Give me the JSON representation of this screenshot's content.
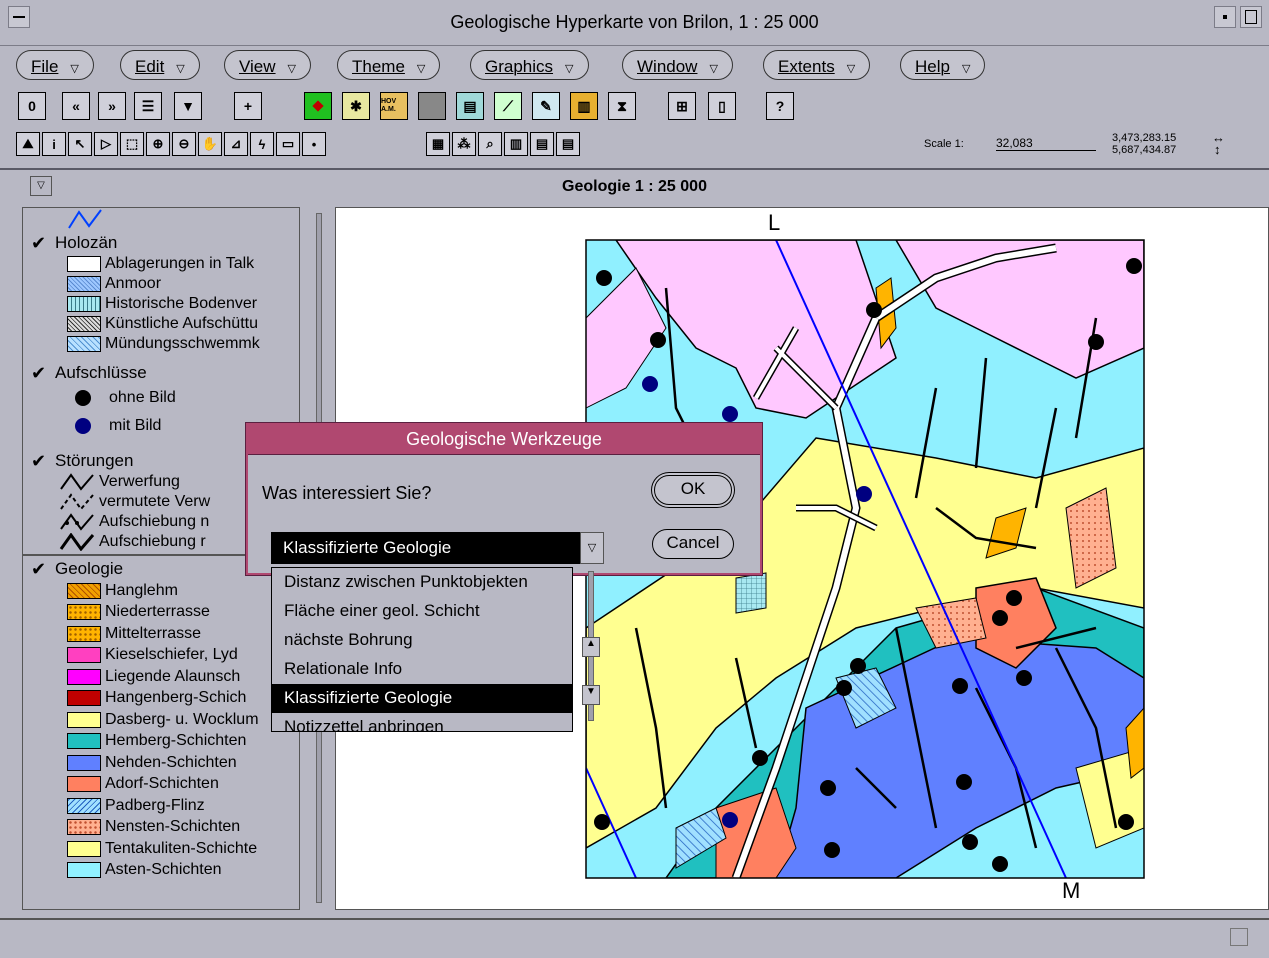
{
  "window": {
    "title": "Geologische Hyperkarte von Brilon, 1 : 25 000"
  },
  "menus": [
    {
      "label": "File"
    },
    {
      "label": "Edit"
    },
    {
      "label": "View"
    },
    {
      "label": "Theme"
    },
    {
      "label": "Graphics"
    },
    {
      "label": "Window"
    },
    {
      "label": "Extents"
    },
    {
      "label": "Help"
    }
  ],
  "toolbar1": {
    "zero_label": "0",
    "prev_label": "«",
    "next_label": "»",
    "hov_label": "HOV A.M."
  },
  "scale": {
    "label": "Scale 1:",
    "value": "32,083",
    "x": "3,473,283.15",
    "y": "5,687,434.87"
  },
  "view": {
    "title": "Geologie 1 : 25 000"
  },
  "legend": {
    "holozaen": {
      "label": "Holozän",
      "items": [
        {
          "label": "Ablagerungen in Talk",
          "color": "#ffffff"
        },
        {
          "label": "Anmoor",
          "color": "#9ec8ff"
        },
        {
          "label": "Historische Bodenver",
          "color": "#a8e8f0"
        },
        {
          "label": "Künstliche Aufschüttu",
          "color": "#c8c8c8"
        },
        {
          "label": "Mündungsschwemmk",
          "color": "#b8e0ff"
        }
      ]
    },
    "aufschluesse": {
      "label": "Aufschlüsse",
      "items": [
        {
          "label": "ohne Bild",
          "color": "#000000"
        },
        {
          "label": "mit Bild",
          "color": "#000080"
        }
      ]
    },
    "stoerungen": {
      "label": "Störungen",
      "items": [
        {
          "label": "Verwerfung"
        },
        {
          "label": "vermutete Verw"
        },
        {
          "label": "Aufschiebung n"
        },
        {
          "label": "Aufschiebung r"
        }
      ]
    },
    "geologie": {
      "label": "Geologie",
      "items": [
        {
          "label": "Hanglehm",
          "color": "#f0a000"
        },
        {
          "label": "Niederterrasse",
          "color": "#ffb400"
        },
        {
          "label": "Mittelterrasse",
          "color": "#ffb400"
        },
        {
          "label": "Kieselschiefer, Lyd",
          "color": "#ff40c0"
        },
        {
          "label": "Liegende Alaunsch",
          "color": "#ff00ff"
        },
        {
          "label": "Hangenberg-Schich",
          "color": "#c00000"
        },
        {
          "label": "Dasberg- u. Wocklum",
          "color": "#ffff90"
        },
        {
          "label": "Hemberg-Schichten",
          "color": "#20c0c0"
        },
        {
          "label": "Nehden-Schichten",
          "color": "#6080ff"
        },
        {
          "label": "Adorf-Schichten",
          "color": "#ff8060"
        },
        {
          "label": "Padberg-Flinz",
          "color": "#a0e0ff"
        },
        {
          "label": "Nensten-Schichten",
          "color": "#ffb090"
        },
        {
          "label": "Tentakuliten-Schichte",
          "color": "#ffff90"
        },
        {
          "label": "Asten-Schichten",
          "color": "#90f0ff"
        }
      ]
    }
  },
  "map": {
    "label_top": "L",
    "label_bottom": "M"
  },
  "dialog": {
    "title": "Geologische Werkzeuge",
    "question": "Was interessiert Sie?",
    "ok_label": "OK",
    "cancel_label": "Cancel",
    "selected": "Klassifizierte Geologie",
    "options": [
      "Distanz zwischen Punktobjekten",
      "Fläche einer geol. Schicht",
      "nächste Bohrung",
      "Relationale Info",
      "Klassifizierte Geologie",
      "Notizzettel anbringen"
    ]
  }
}
